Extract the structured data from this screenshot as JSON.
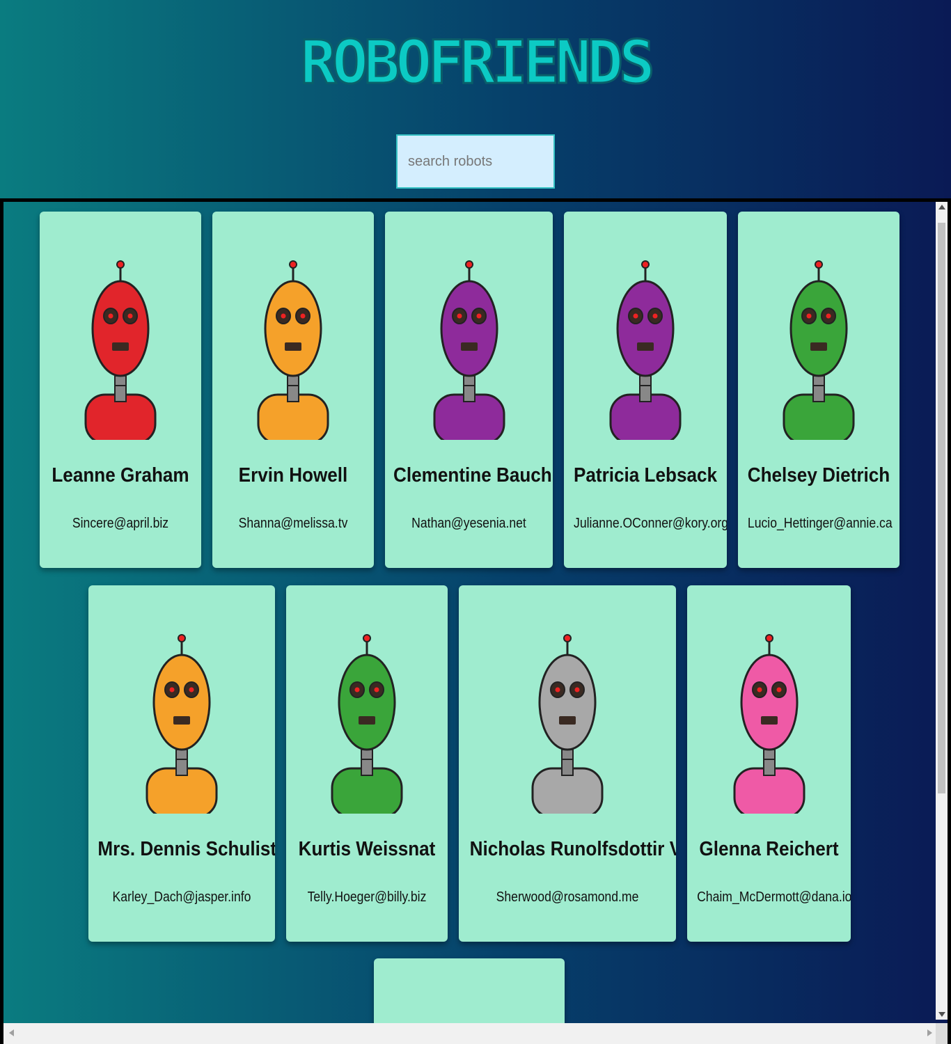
{
  "app": {
    "title": "ROBOFRIENDS"
  },
  "search": {
    "placeholder": "search robots",
    "value": ""
  },
  "robots": [
    {
      "name": "Leanne Graham",
      "email": "Sincere@april.biz",
      "color": "#e1252b"
    },
    {
      "name": "Ervin Howell",
      "email": "Shanna@melissa.tv",
      "color": "#f5a12a"
    },
    {
      "name": "Clementine Bauch",
      "email": "Nathan@yesenia.net",
      "color": "#8e2b9b"
    },
    {
      "name": "Patricia Lebsack",
      "email": "Julianne.OConner@kory.org",
      "color": "#8e2b9b"
    },
    {
      "name": "Chelsey Dietrich",
      "email": "Lucio_Hettinger@annie.ca",
      "color": "#3aa53a"
    },
    {
      "name": "Mrs. Dennis Schulist",
      "email": "Karley_Dach@jasper.info",
      "color": "#f5a12a"
    },
    {
      "name": "Kurtis Weissnat",
      "email": "Telly.Hoeger@billy.biz",
      "color": "#3aa53a"
    },
    {
      "name": "Nicholas Runolfsdottir V",
      "email": "Sherwood@rosamond.me",
      "color": "#a8a8a8"
    },
    {
      "name": "Glenna Reichert",
      "email": "Chaim_McDermott@dana.io",
      "color": "#ef5aa6"
    }
  ],
  "partial_card": {
    "color": "#3aa53a"
  }
}
